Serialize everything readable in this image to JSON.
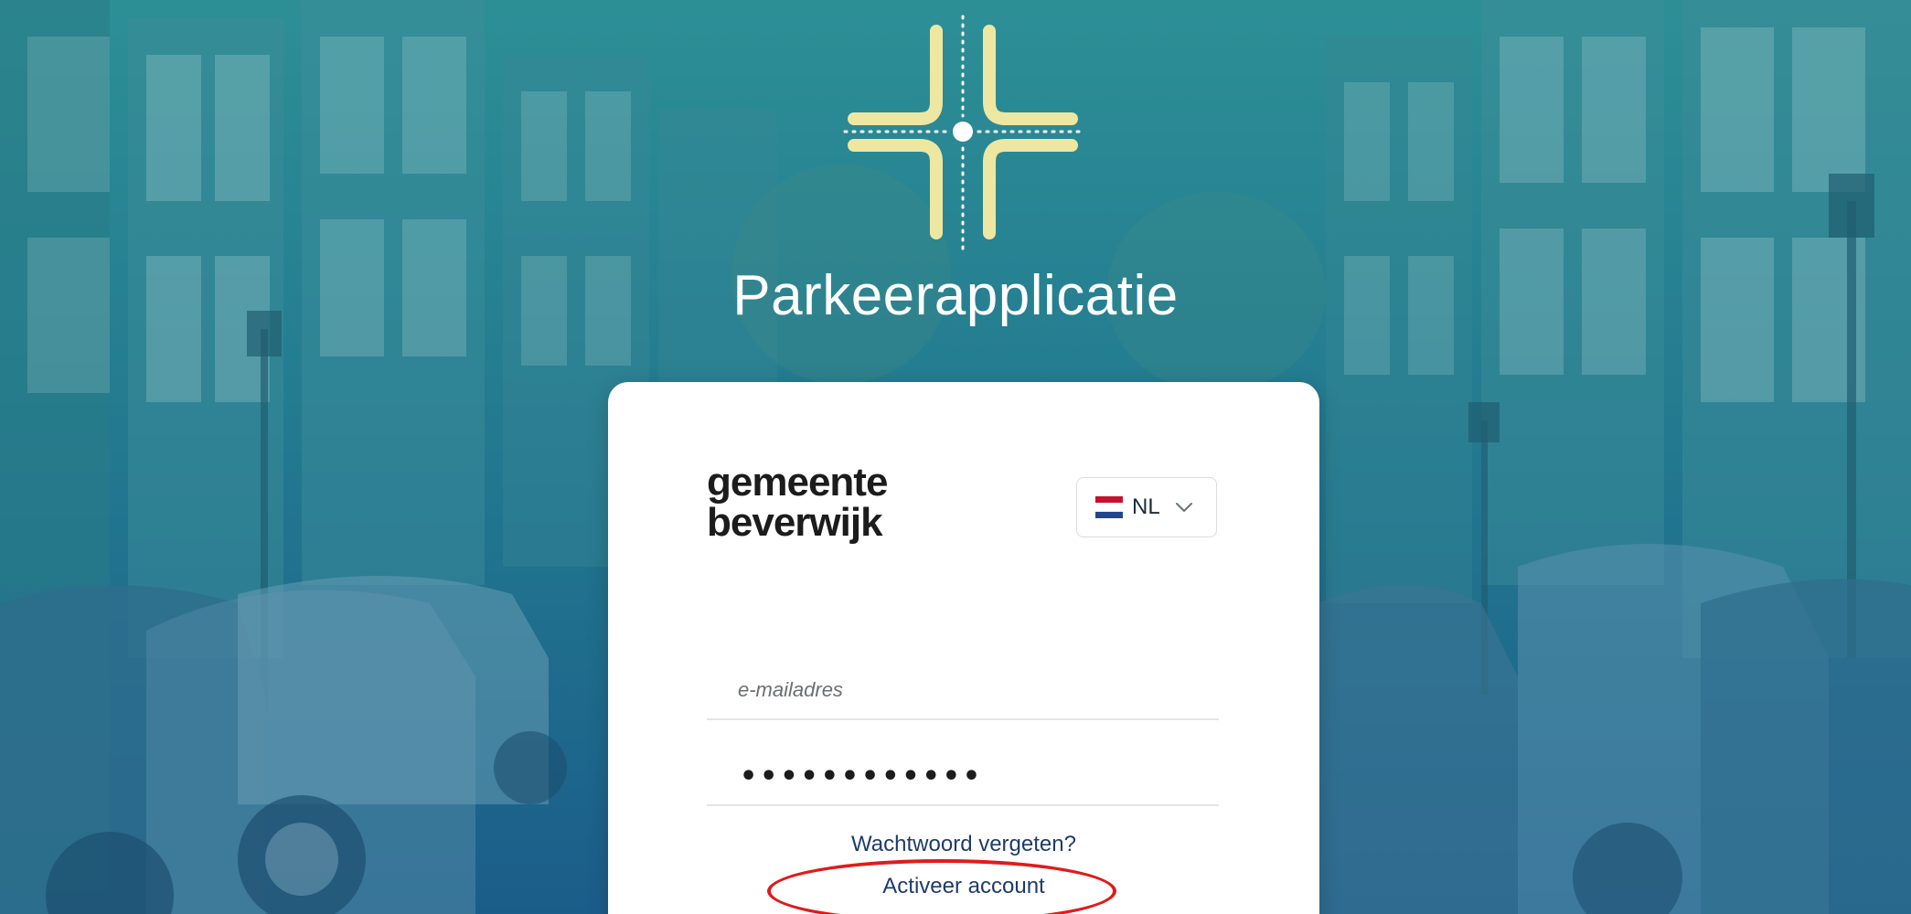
{
  "app": {
    "title": "Parkeerapplicatie"
  },
  "municipality": {
    "logo_line1": "gemeente",
    "logo_line2": "beverwijk"
  },
  "language_selector": {
    "selected": "NL",
    "flag_icon": "netherlands-flag-icon",
    "chevron_icon": "chevron-down-icon"
  },
  "login_form": {
    "email_placeholder": "e-mailadres",
    "email_value": "",
    "password_masked": "••••••••••••",
    "forgot_password_label": "Wachtwoord vergeten?",
    "activate_account_label": "Activeer account"
  },
  "colors": {
    "logo_cross": "#ede7a2",
    "link": "#1f3b6b",
    "highlight": "#e01b1b",
    "background_top": "#2d8f96",
    "background_bottom": "#1b5d8a"
  }
}
